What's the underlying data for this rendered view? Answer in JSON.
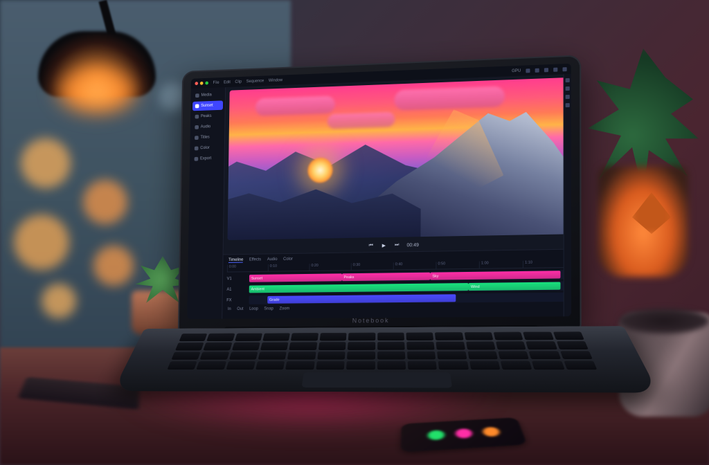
{
  "scene": {
    "description": "Laptop on a wooden desk at dusk showing a video-editing application with a mountain-sunset clip in the preview and a multi-track timeline. Warm desk lamp, bokeh city lights through window, potted plants, a phone, a mug and a notebook surround it.",
    "laptop_brand": "Notebook"
  },
  "colors": {
    "track_video": "#ff2ea6",
    "track_audio": "#19e27d",
    "track_fx": "#4a49ff",
    "accent": "#3f46ff",
    "traffic": [
      "#ff5f57",
      "#febc2e",
      "#28c840"
    ]
  },
  "menubar": {
    "left": [
      "File",
      "Edit",
      "Clip",
      "Sequence",
      "Window"
    ],
    "right_status": "GPU",
    "right_icons": [
      "settings",
      "layout",
      "search",
      "export",
      "close"
    ]
  },
  "sidebar": {
    "items": [
      {
        "label": "Media"
      },
      {
        "label": "Sunset"
      },
      {
        "label": "Peaks"
      },
      {
        "label": "Audio"
      },
      {
        "label": "Titles"
      },
      {
        "label": "Color"
      },
      {
        "label": "Export"
      }
    ],
    "active_index": 1
  },
  "transport": {
    "timecode": "00:49",
    "buttons": [
      "prev",
      "play",
      "next"
    ]
  },
  "timeline": {
    "tabs": [
      "Timeline",
      "Effects",
      "Audio",
      "Color"
    ],
    "active_tab": 0,
    "ruler": [
      "0:00",
      "0:10",
      "0:20",
      "0:30",
      "0:40",
      "0:50",
      "1:00",
      "1:10"
    ],
    "tracks": [
      {
        "label": "V1",
        "color_key": "track_video",
        "clips": [
          {
            "label": "Sunset",
            "start_pct": 0,
            "width_pct": 30
          },
          {
            "label": "Peaks",
            "start_pct": 30,
            "width_pct": 28
          },
          {
            "label": "Sky",
            "start_pct": 58,
            "width_pct": 40
          }
        ]
      },
      {
        "label": "A1",
        "color_key": "track_audio",
        "clips": [
          {
            "label": "Ambient",
            "start_pct": 0,
            "width_pct": 70
          },
          {
            "label": "Wind",
            "start_pct": 70,
            "width_pct": 28
          }
        ]
      },
      {
        "label": "FX",
        "color_key": "track_fx",
        "clips": [
          {
            "label": "Grade",
            "start_pct": 6,
            "width_pct": 60
          }
        ]
      }
    ],
    "footer_markers": [
      "In",
      "Out",
      "Loop",
      "Snap",
      "Zoom"
    ]
  }
}
